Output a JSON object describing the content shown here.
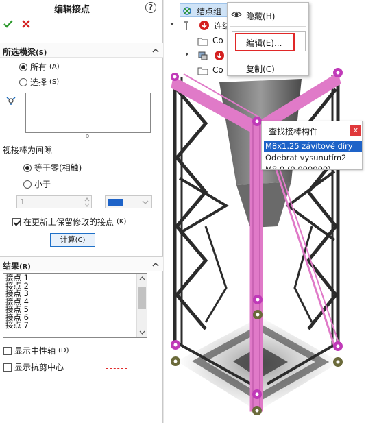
{
  "pm": {
    "title": "编辑接点",
    "help": "?",
    "selected_members": {
      "header": "所选横梁",
      "header_key": "(S)",
      "option_all": "所有",
      "option_all_key": "(A)",
      "option_select": "选择",
      "option_select_key": "(S)"
    },
    "gap": {
      "label": "视接棒为间隙",
      "option_zero": "等于零(相触)",
      "option_less": "小于",
      "value": "1",
      "keep_label": "在更新上保留修改的接点",
      "keep_key": "(K)",
      "calc_button": "计算",
      "calc_key": "(C)"
    },
    "results": {
      "header": "结果",
      "header_key": "(R)",
      "items": [
        "接点 1",
        "接点 2",
        "接点 3",
        "接点 4",
        "接点 5",
        "接点 6",
        "接点 7"
      ],
      "show_neutral_axis": "显示中性轴",
      "show_neutral_axis_key": "(D)",
      "show_shear_center": "显示抗剪中心",
      "neutral_line_color": "#222222",
      "shear_line_color": "#e02828"
    }
  },
  "tree": {
    "node1": "结点组",
    "node2": "连结",
    "node3": "Co",
    "node4": "Co"
  },
  "context_menu": {
    "hide": "隐藏",
    "hide_key": "(H)",
    "edit": "编辑",
    "edit_key": "(E)...",
    "copy": "复制",
    "copy_key": "(C)"
  },
  "popup": {
    "title": "查找接棒构件",
    "close": "x",
    "rows": [
      "M8x1.25 závitové díry",
      "Odebrat vysunutím2",
      "M8.0 (0.000000)"
    ]
  },
  "colors": {
    "accent": "#1e63c8",
    "highlight_member": "#e07ac8",
    "joint_magenta": "#c03ab8",
    "joint_olive": "#6b6a3a",
    "ok_green": "#2e9a2e",
    "cancel_red": "#d42020"
  }
}
